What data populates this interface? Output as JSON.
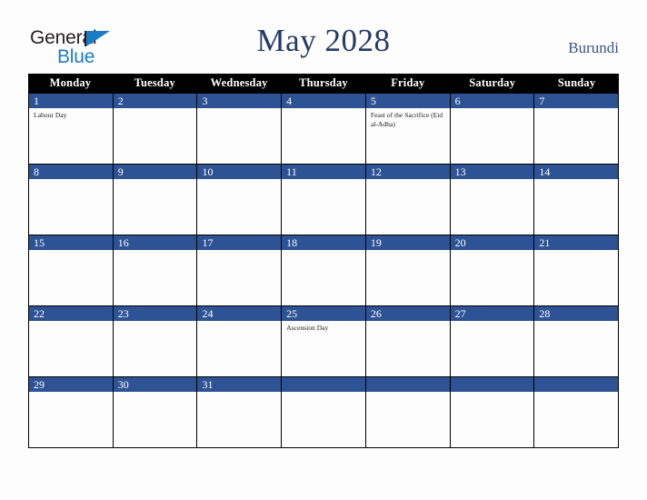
{
  "brand": {
    "name_part1": "General",
    "name_part2": "Blue",
    "triangle_color": "#1b7bc4"
  },
  "header": {
    "title": "May 2028",
    "country": "Burundi",
    "title_color": "#253a66",
    "country_color": "#3c547f"
  },
  "calendar": {
    "weekdays": [
      "Monday",
      "Tuesday",
      "Wednesday",
      "Thursday",
      "Friday",
      "Saturday",
      "Sunday"
    ],
    "header_bg": "#000000",
    "daybar_bg": "#2e5395",
    "weeks": [
      [
        {
          "day": "1",
          "events": [
            "Labour Day"
          ]
        },
        {
          "day": "2",
          "events": []
        },
        {
          "day": "3",
          "events": []
        },
        {
          "day": "4",
          "events": []
        },
        {
          "day": "5",
          "events": [
            "Feast of the Sacrifice (Eid al-Adha)"
          ]
        },
        {
          "day": "6",
          "events": []
        },
        {
          "day": "7",
          "events": []
        }
      ],
      [
        {
          "day": "8",
          "events": []
        },
        {
          "day": "9",
          "events": []
        },
        {
          "day": "10",
          "events": []
        },
        {
          "day": "11",
          "events": []
        },
        {
          "day": "12",
          "events": []
        },
        {
          "day": "13",
          "events": []
        },
        {
          "day": "14",
          "events": []
        }
      ],
      [
        {
          "day": "15",
          "events": []
        },
        {
          "day": "16",
          "events": []
        },
        {
          "day": "17",
          "events": []
        },
        {
          "day": "18",
          "events": []
        },
        {
          "day": "19",
          "events": []
        },
        {
          "day": "20",
          "events": []
        },
        {
          "day": "21",
          "events": []
        }
      ],
      [
        {
          "day": "22",
          "events": []
        },
        {
          "day": "23",
          "events": []
        },
        {
          "day": "24",
          "events": []
        },
        {
          "day": "25",
          "events": [
            "Ascension Day"
          ]
        },
        {
          "day": "26",
          "events": []
        },
        {
          "day": "27",
          "events": []
        },
        {
          "day": "28",
          "events": []
        }
      ],
      [
        {
          "day": "29",
          "events": []
        },
        {
          "day": "30",
          "events": []
        },
        {
          "day": "31",
          "events": []
        },
        {
          "day": "",
          "events": []
        },
        {
          "day": "",
          "events": []
        },
        {
          "day": "",
          "events": []
        },
        {
          "day": "",
          "events": []
        }
      ]
    ]
  }
}
